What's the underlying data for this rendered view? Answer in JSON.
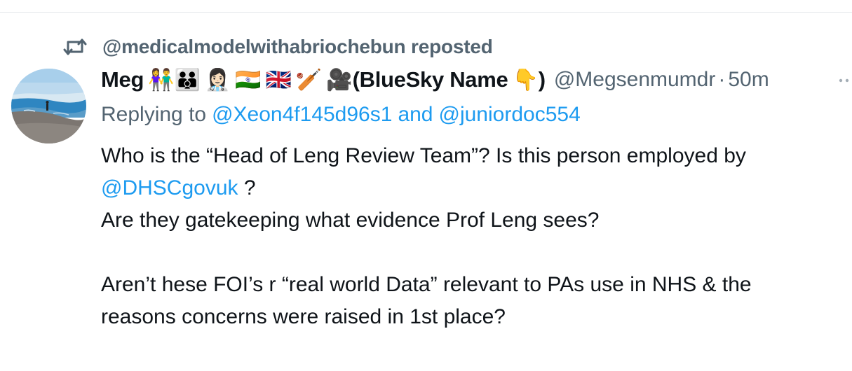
{
  "repost": {
    "text": "@medicalmodelwithabriochebun reposted",
    "icon": "repost-icon"
  },
  "tweet": {
    "display_name": "Meg",
    "name_emojis": [
      "👫👪",
      "👩🏻‍⚕️",
      "🇮🇳",
      "🇬🇧",
      "🏏",
      "🎥"
    ],
    "name_tail_text": "(BlueSky Name ",
    "name_tail_emoji": "👇",
    "name_tail_close": ")",
    "handle": "@Megsenmumdr",
    "separator": "·",
    "time": "50m",
    "replying_prefix": "Replying to",
    "reply_user_1": "@Xeon4f145d96s1",
    "reply_and": "and",
    "reply_user_2": "@juniordoc554",
    "line1": "Who is the “Head of Leng Review Team”? Is this person employed by",
    "mention": "@DHSCgovuk",
    "line2_tail": " ?",
    "line3": "Are they gatekeeping what evidence Prof Leng sees?",
    "line4": "Aren’t hese FOI’s r “real world Data” relevant to PAs use in NHS & the",
    "line5": "reasons concerns were raised in 1st place?"
  },
  "colors": {
    "link": "#1d9bf0",
    "secondary_text": "#536471",
    "primary_text": "#0f1419"
  }
}
